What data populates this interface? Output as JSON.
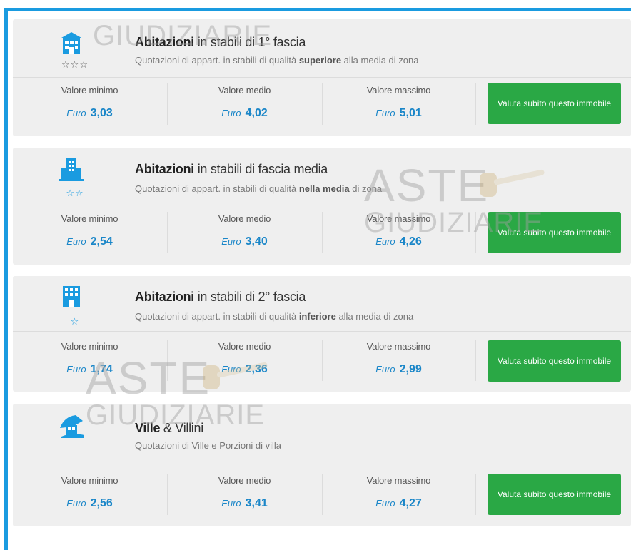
{
  "cards": [
    {
      "icon": "building-house-icon",
      "stars": "☆☆☆",
      "title_bold": "Abitazioni",
      "title_rest": " in stabili di 1° fascia",
      "sub_pre": "Quotazioni di appart. in stabili di qualità ",
      "sub_bold": "superiore",
      "sub_post": " alla media di zona",
      "min_label": "Valore minimo",
      "min_cur": "Euro",
      "min_val": "3,03",
      "med_label": "Valore medio",
      "med_cur": "Euro",
      "med_val": "4,02",
      "max_label": "Valore massimo",
      "max_cur": "Euro",
      "max_val": "5,01",
      "cta": "Valuta subito questo immobile"
    },
    {
      "icon": "apartment-tower-icon",
      "stars": "☆☆",
      "title_bold": "Abitazioni",
      "title_rest": " in stabili di fascia media",
      "sub_pre": "Quotazioni di appart. in stabili di qualità ",
      "sub_bold": "nella media",
      "sub_post": " di zona",
      "min_label": "Valore minimo",
      "min_cur": "Euro",
      "min_val": "2,54",
      "med_label": "Valore medio",
      "med_cur": "Euro",
      "med_val": "3,40",
      "max_label": "Valore massimo",
      "max_cur": "Euro",
      "max_val": "4,26",
      "cta": "Valuta subito questo immobile"
    },
    {
      "icon": "office-building-icon",
      "stars": "☆",
      "title_bold": "Abitazioni",
      "title_rest": " in stabili di 2° fascia",
      "sub_pre": "Quotazioni di appart. in stabili di qualità ",
      "sub_bold": "inferiore",
      "sub_post": " alla media di zona",
      "min_label": "Valore minimo",
      "min_cur": "Euro",
      "min_val": "1,74",
      "med_label": "Valore medio",
      "med_cur": "Euro",
      "med_val": "2,36",
      "max_label": "Valore massimo",
      "max_cur": "Euro",
      "max_val": "2,99",
      "cta": "Valuta subito questo immobile"
    },
    {
      "icon": "villa-house-icon",
      "stars": "",
      "title_bold": "Ville",
      "title_rest": " & Villini",
      "sub_pre": "Quotazioni di Ville e Porzioni di villa",
      "sub_bold": "",
      "sub_post": "",
      "min_label": "Valore minimo",
      "min_cur": "Euro",
      "min_val": "2,56",
      "med_label": "Valore medio",
      "med_cur": "Euro",
      "med_val": "3,41",
      "max_label": "Valore massimo",
      "max_cur": "Euro",
      "max_val": "4,27",
      "cta": "Valuta subito questo immobile"
    }
  ],
  "watermark": {
    "line1": "ASTE",
    "line2": "GIUDIZIARIE",
    "reg": "®"
  },
  "colors": {
    "accent": "#1a9be0",
    "value": "#1a86c8",
    "cta": "#2aa845",
    "card": "#efefef"
  }
}
